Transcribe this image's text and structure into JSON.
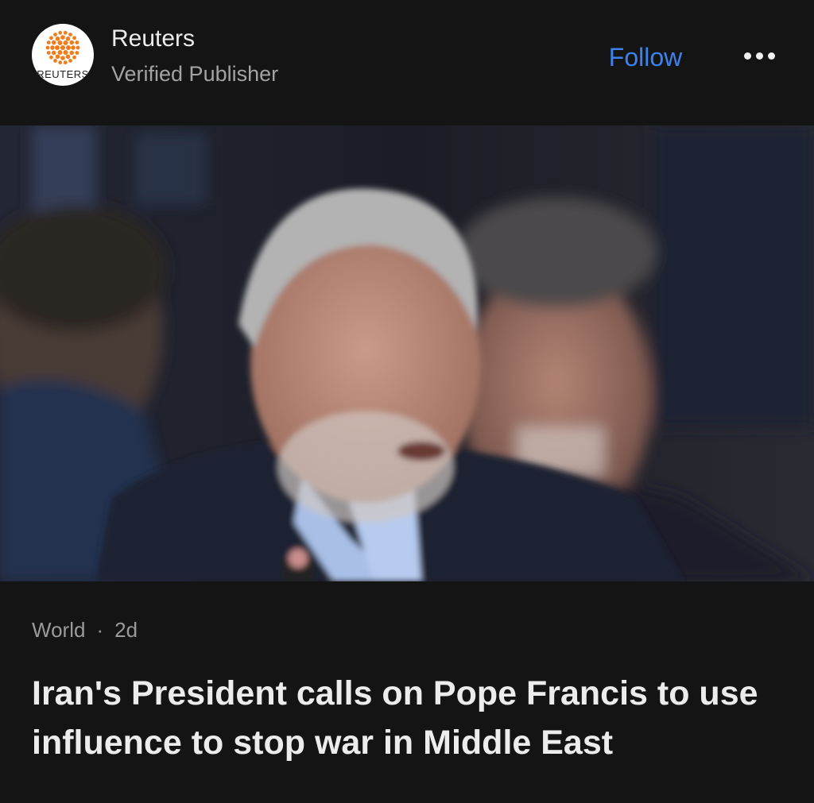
{
  "publisher": {
    "name": "Reuters",
    "subtitle": "Verified Publisher",
    "logo_text": "REUTERS",
    "logo_color": "#f07c1a"
  },
  "actions": {
    "follow_label": "Follow",
    "more_icon": "more-horizontal-icon",
    "accent_color": "#3b82f0"
  },
  "article": {
    "category": "World",
    "separator": "·",
    "age": "2d",
    "headline": "Iran's President calls on Pope Francis to use influence to stop war in Middle East"
  }
}
